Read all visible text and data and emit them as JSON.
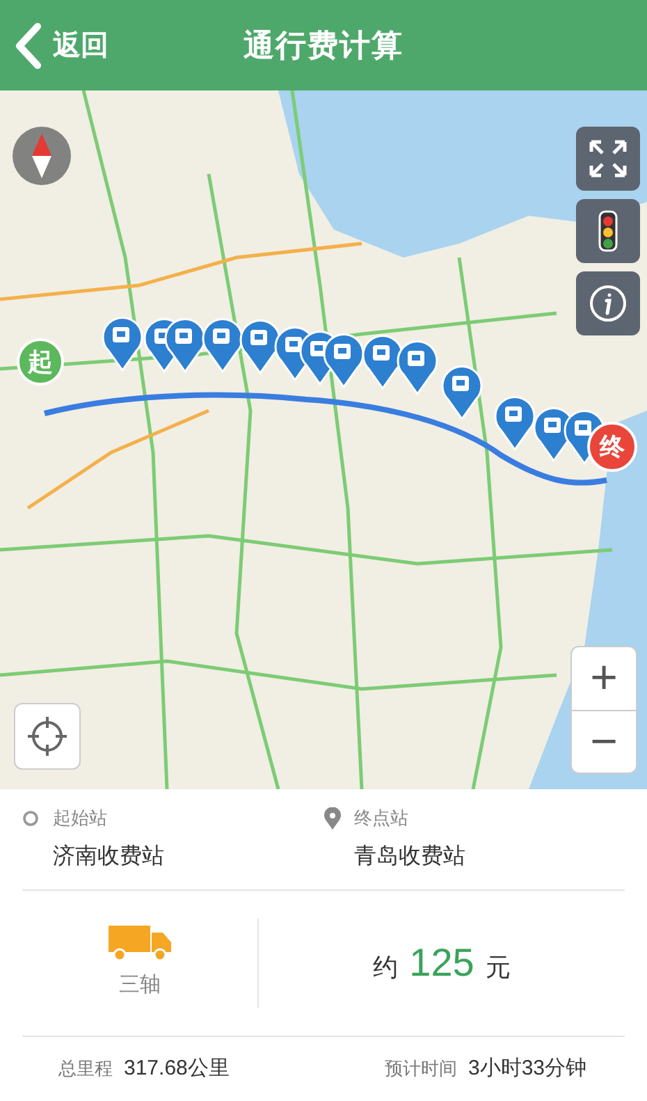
{
  "header": {
    "back": "返回",
    "title": "通行费计算"
  },
  "map": {
    "start_marker": "起",
    "end_marker": "终",
    "zoom_in": "+",
    "zoom_out": "−"
  },
  "stations": [
    {
      "kind": "start",
      "label": "起始站",
      "name": "济南收费站"
    },
    {
      "kind": "end",
      "label": "终点站",
      "name": "青岛收费站"
    }
  ],
  "vehicle": {
    "axles": "三轴"
  },
  "price": {
    "prefix": "约",
    "amount": "125",
    "unit": "元"
  },
  "summary": [
    {
      "label": "总里程",
      "value": "317.68公里"
    },
    {
      "label": "预计时间",
      "value": "3小时33分钟"
    }
  ]
}
